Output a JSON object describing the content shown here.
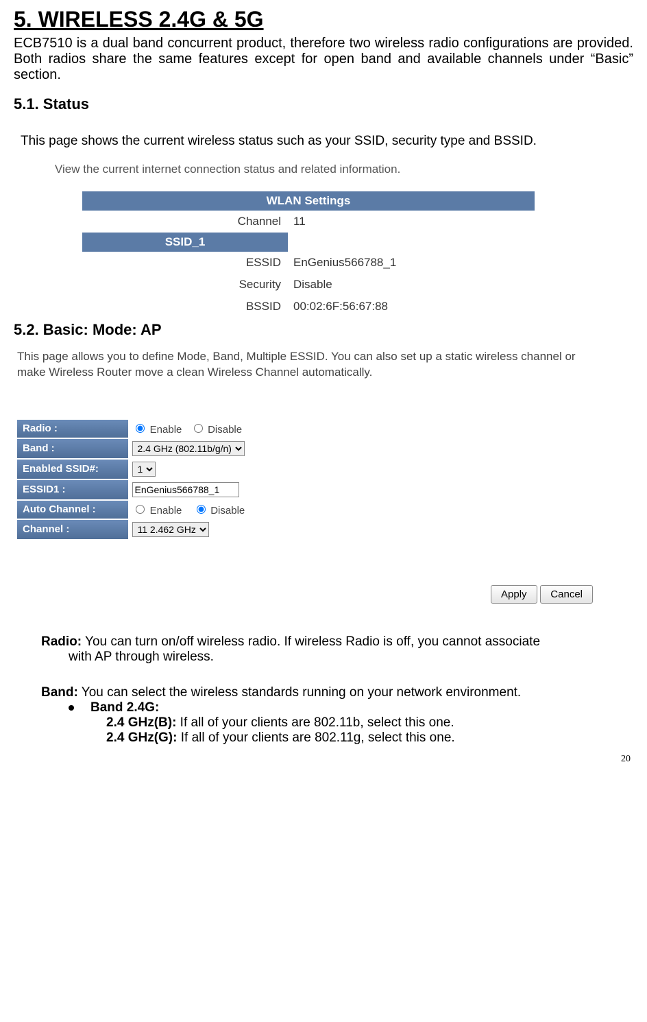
{
  "heading_main": "5. WIRELESS 2.4G & 5G",
  "intro": "ECB7510 is a dual band concurrent product, therefore two wireless radio configurations are provided. Both radios share the same features except for open band and available channels under “Basic” section.",
  "heading_status": "5.1. Status",
  "status_desc": "This page shows the current wireless status such as your SSID, security type and BSSID.",
  "shot1": {
    "caption": "View the current internet connection status and related information.",
    "header": "WLAN Settings",
    "channel_label": "Channel",
    "channel_value": "11",
    "ssid_header": "SSID_1",
    "essid_label": "ESSID",
    "essid_value": "EnGenius566788_1",
    "security_label": "Security",
    "security_value": "Disable",
    "bssid_label": "BSSID",
    "bssid_value": "00:02:6F:56:67:88"
  },
  "heading_basic": "5.2. Basic: Mode: AP",
  "shot2": {
    "caption": "This page allows you to define Mode, Band, Multiple ESSID. You can also set up a static wireless channel or make Wireless Router move a clean Wireless Channel automatically.",
    "radio_label": "Radio :",
    "radio_enable": "Enable",
    "radio_disable": "Disable",
    "band_label": "Band :",
    "band_value": "2.4 GHz (802.11b/g/n)",
    "enabled_ssid_label": "Enabled SSID#:",
    "enabled_ssid_value": "1",
    "essid1_label": "ESSID1 :",
    "essid1_value": "EnGenius566788_1",
    "auto_channel_label": "Auto Channel :",
    "auto_enable": "Enable",
    "auto_disable": "Disable",
    "channel_label": "Channel :",
    "channel_value": "11  2.462 GHz",
    "btn_apply": "Apply",
    "btn_cancel": "Cancel"
  },
  "radio_def_term": "Radio:",
  "radio_def_body1": " You can turn on/off wireless radio. If wireless Radio is off, you cannot associate",
  "radio_def_body2": "with AP through wireless.",
  "band_def_term": "Band:",
  "band_def_body": " You can select the wireless standards running on your network environment.",
  "band_24_label": "Band 2.4G:",
  "ghz_b_term": "2.4 GHz(B):",
  "ghz_b_body": " If all of your clients are 802.11b, select this one.",
  "ghz_g_term": "2.4 GHz(G):",
  "ghz_g_body": " If all of your clients are 802.11g, select this one.",
  "page_no": "20"
}
